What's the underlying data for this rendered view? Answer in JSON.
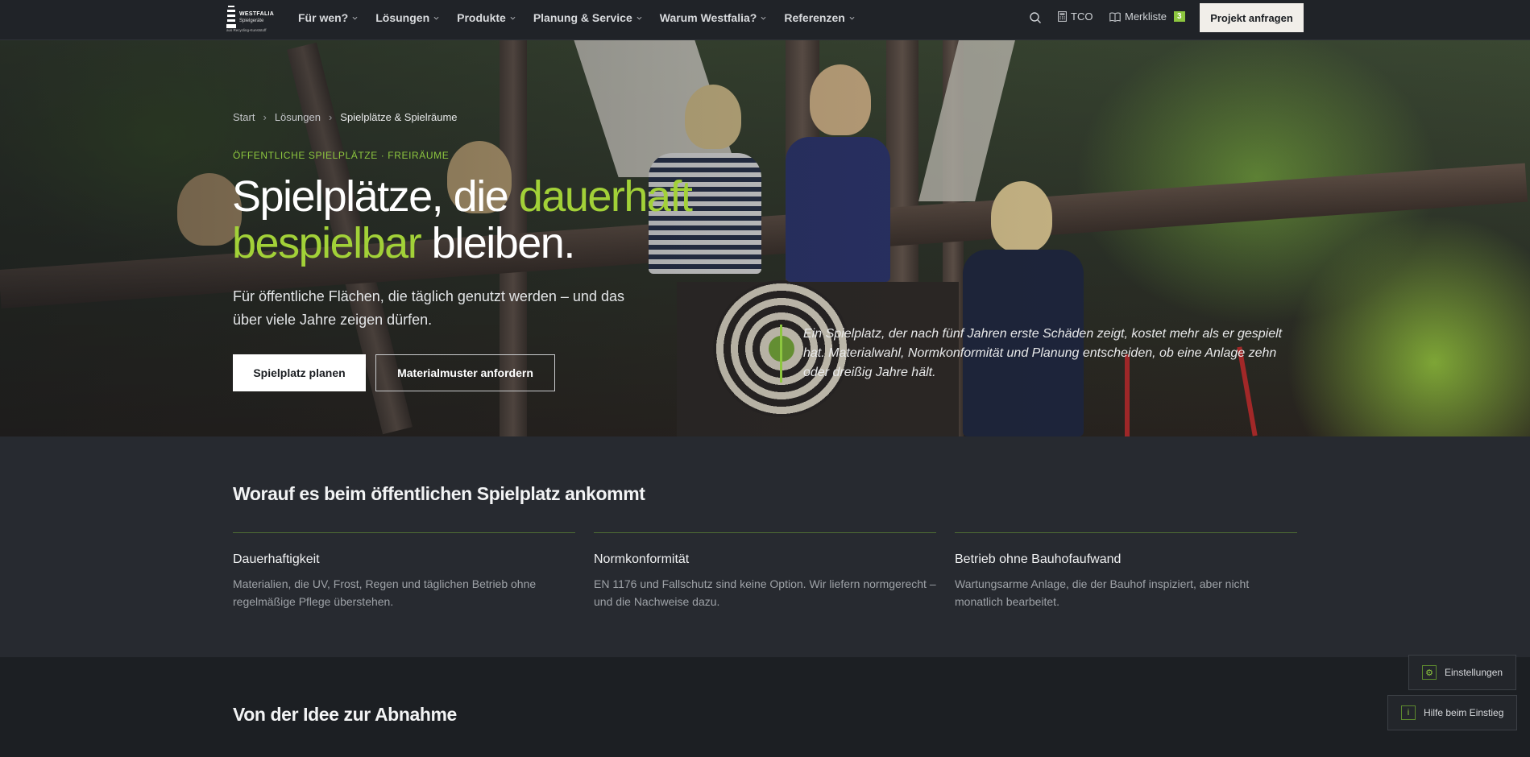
{
  "brand": {
    "name": "WESTFALIA",
    "sub": "Spielgeräte",
    "tagline": "aus Recycling-Kunststoff"
  },
  "nav": {
    "items": [
      {
        "label": "Für wen?"
      },
      {
        "label": "Lösungen"
      },
      {
        "label": "Produkte"
      },
      {
        "label": "Planung & Service"
      },
      {
        "label": "Warum Westfalia?"
      },
      {
        "label": "Referenzen"
      }
    ],
    "tco_label": "TCO",
    "merkliste_label": "Merkliste",
    "merkliste_count": "3",
    "cta_label": "Projekt anfragen"
  },
  "hero": {
    "breadcrumb": [
      "Start",
      "Lösungen",
      "Spielplätze & Spielräume"
    ],
    "eyebrow": "ÖFFENTLICHE SPIELPLÄTZE · FREIRÄUME",
    "headline_part1": "Spielplätze, die ",
    "headline_accent": "dauerhaft bespielbar",
    "headline_part2": " bleiben.",
    "lead": "Für öffentliche Flächen, die täglich genutzt werden – und das über viele Jahre zeigen dürfen.",
    "primary_cta": "Spielplatz planen",
    "secondary_cta": "Materialmuster anfordern",
    "quote": "Ein Spielplatz, der nach fünf Jahren erste Schäden zeigt, kostet mehr als er gespielt hat. Materialwahl, Normkonformität und Planung entscheiden, ob eine Anlage zehn oder dreißig Jahre hält."
  },
  "section1": {
    "title": "Worauf es beim öffentlichen Spielplatz ankommt",
    "columns": [
      {
        "title": "Dauerhaftigkeit",
        "text": "Materialien, die UV, Frost, Regen und täglichen Betrieb ohne regelmäßige Pflege überstehen."
      },
      {
        "title": "Normkonformität",
        "text": "EN 1176 und Fallschutz sind keine Option. Wir liefern normgerecht – und die Nachweise dazu."
      },
      {
        "title": "Betrieb ohne Bauhofaufwand",
        "text": "Wartungsarme Anlage, die der Bauhof inspiziert, aber nicht monatlich bearbeitet."
      }
    ]
  },
  "section2": {
    "title": "Von der Idee zur Abnahme"
  },
  "widgets": {
    "settings_label": "Einstellungen",
    "help_label": "Hilfe beim Einstieg"
  },
  "colors": {
    "accent": "#8dc63f",
    "headline_accent": "#a2d138",
    "nav_bg": "#202328",
    "section_bg": "#272a30",
    "dark_bg": "#1c1f23"
  }
}
